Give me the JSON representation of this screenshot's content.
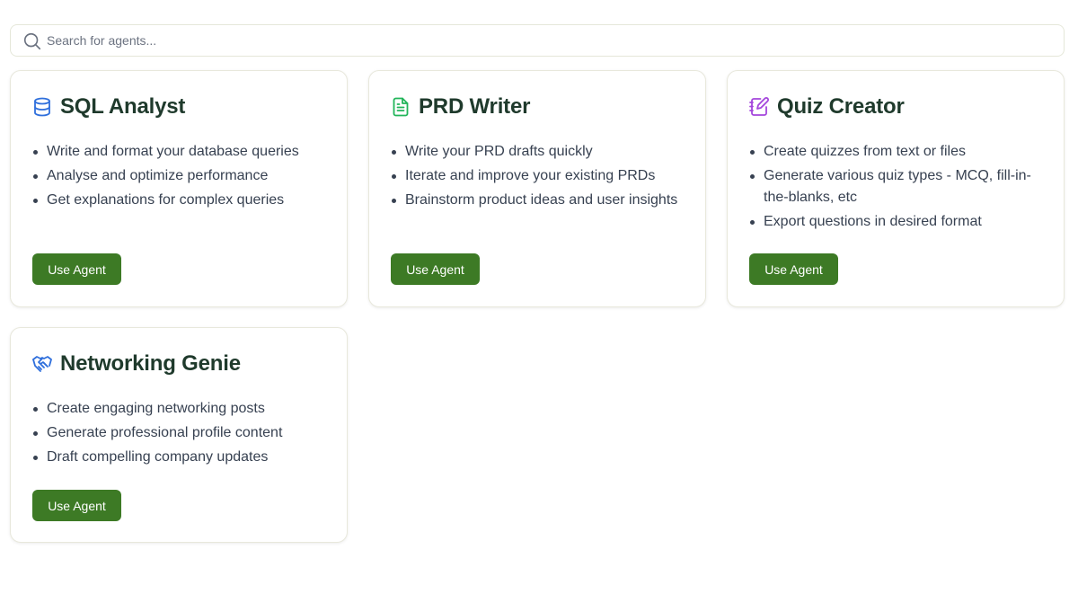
{
  "search": {
    "placeholder": "Search for agents..."
  },
  "colors": {
    "accent_button": "#3d7a25",
    "title_text": "#1f3a2c"
  },
  "agents": [
    {
      "title": "SQL Analyst",
      "icon": "database-icon",
      "icon_color": "#2f6fdc",
      "bullets": [
        "Write and format your database queries",
        "Analyse and optimize performance",
        "Get explanations for complex queries"
      ],
      "button": "Use Agent"
    },
    {
      "title": "PRD Writer",
      "icon": "document-icon",
      "icon_color": "#22b55a",
      "bullets": [
        "Write your PRD drafts quickly",
        "Iterate and improve your existing PRDs",
        "Brainstorm product ideas and user insights"
      ],
      "button": "Use Agent"
    },
    {
      "title": "Quiz Creator",
      "icon": "notebook-pen-icon",
      "icon_color": "#a446dc",
      "bullets": [
        "Create quizzes from text or files",
        "Generate various quiz types - MCQ, fill-in-the-blanks, etc",
        "Export questions in desired format"
      ],
      "button": "Use Agent"
    },
    {
      "title": "Networking Genie",
      "icon": "handshake-icon",
      "icon_color": "#2f6fdc",
      "bullets": [
        "Create engaging networking posts",
        "Generate professional profile content",
        "Draft compelling company updates"
      ],
      "button": "Use Agent"
    }
  ]
}
